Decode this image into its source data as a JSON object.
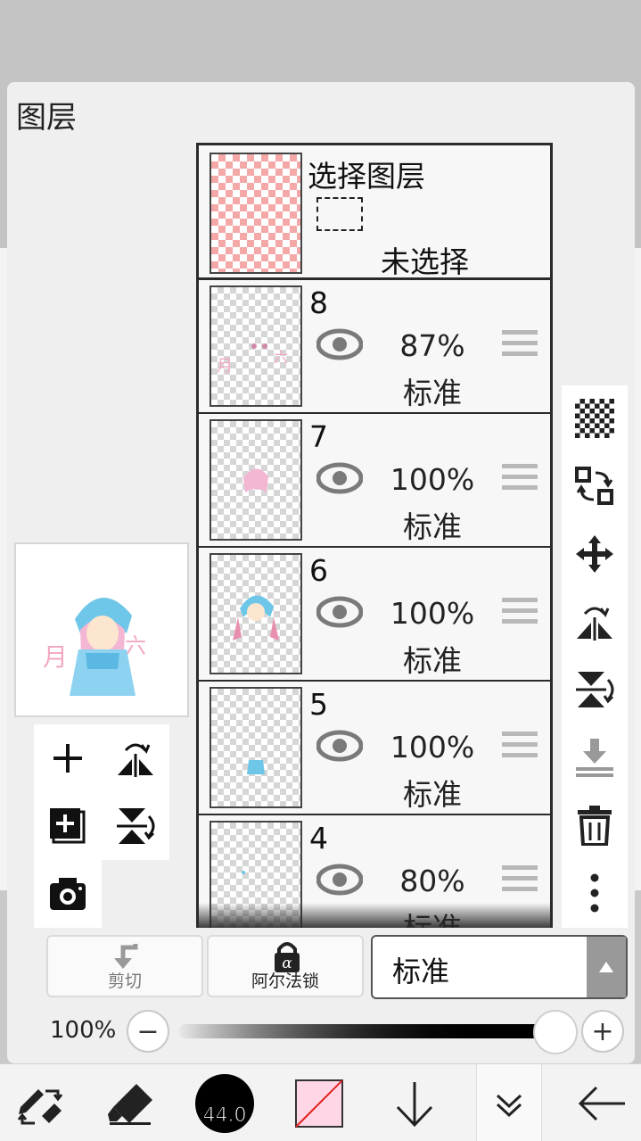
{
  "panel": {
    "title": "图层"
  },
  "selection_layer": {
    "title": "选择图层",
    "status": "未选择"
  },
  "layers": [
    {
      "number": "8",
      "opacity": "87%",
      "blend": "标准"
    },
    {
      "number": "7",
      "opacity": "100%",
      "blend": "标准"
    },
    {
      "number": "6",
      "opacity": "100%",
      "blend": "标准"
    },
    {
      "number": "5",
      "opacity": "100%",
      "blend": "标准"
    },
    {
      "number": "4",
      "opacity": "80%",
      "blend": "标准"
    }
  ],
  "controls": {
    "cut_label": "剪切",
    "alpha_lock_label": "阿尔法锁",
    "blend_mode": "标准",
    "opacity_label": "100%",
    "opacity_value": 1.0,
    "minus": "−",
    "plus": "+"
  },
  "toolbar": {
    "brush_size": "44.0",
    "brush_color": "#000000",
    "secondary_color": "#ffd6e6"
  },
  "icons": {
    "right_tools": [
      "checker-transparency-icon",
      "layer-swap-icon",
      "move-icon",
      "flip-horizontal-icon",
      "flip-vertical-icon",
      "merge-down-icon",
      "trash-icon",
      "more-vertical-icon"
    ],
    "left_tools": [
      "add-layer-icon",
      "flip-horizontal-icon",
      "add-layer-copy-icon",
      "flip-vertical-icon",
      "camera-icon"
    ],
    "bottom_tools": [
      "transform-tool-icon",
      "eraser-icon",
      "brush-size-icon",
      "color-swatch-icon",
      "down-arrow-icon",
      "collapse-icon",
      "back-arrow-icon"
    ]
  },
  "colors": {
    "accent": "#2b2b2b",
    "eye": "#7a7a7a",
    "pink_checker": "#f5a8a8"
  }
}
